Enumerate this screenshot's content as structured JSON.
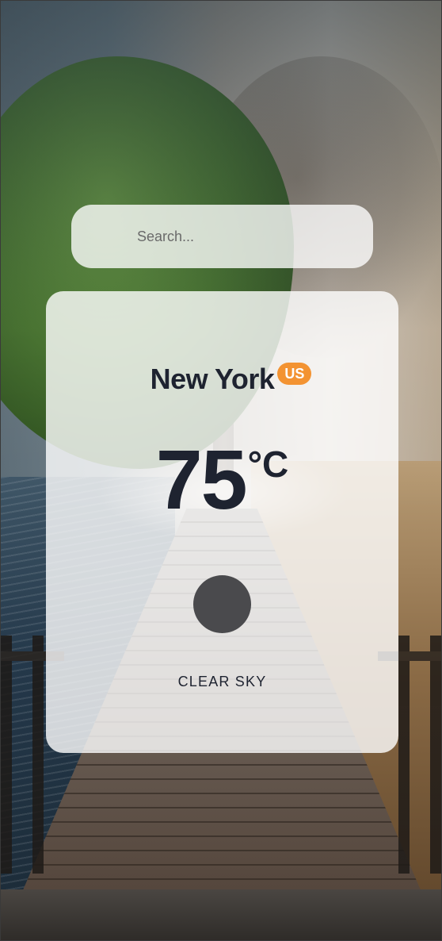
{
  "search": {
    "placeholder": "Search...",
    "value": ""
  },
  "weather": {
    "city": "New York",
    "country_code": "US",
    "temperature": "75",
    "unit": "°C",
    "description": "CLEAR SKY",
    "icon": "weather-icon-placeholder"
  },
  "colors": {
    "badge": "#f39332",
    "text_primary": "#1e2330",
    "icon_placeholder": "#4a4a4d"
  }
}
